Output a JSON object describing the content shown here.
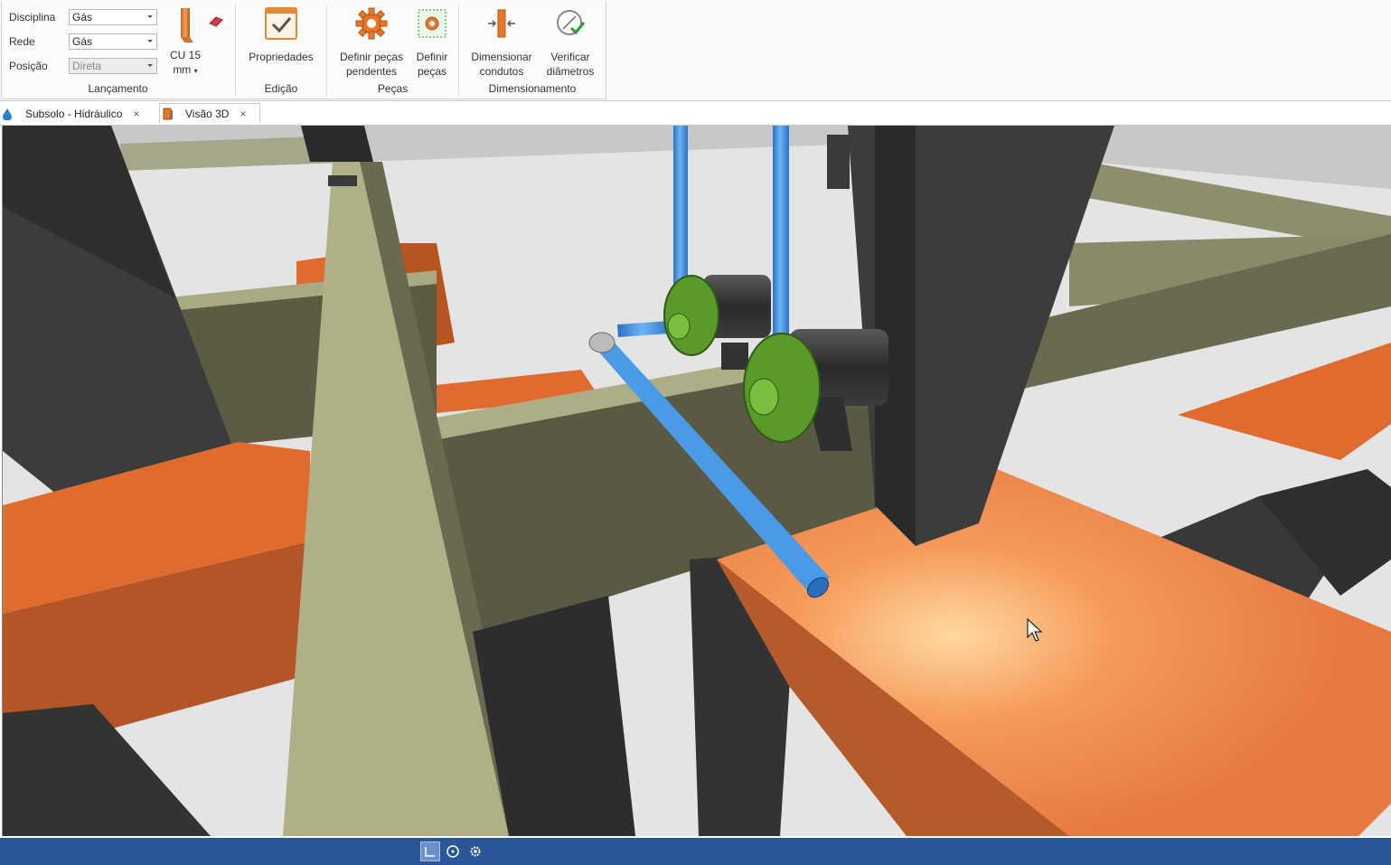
{
  "ribbon": {
    "lancamento": {
      "label": "Lançamento",
      "disciplina": {
        "label": "Disciplina",
        "value": "Gás"
      },
      "rede": {
        "label": "Rede",
        "value": "Gás"
      },
      "posicao": {
        "label": "Posição",
        "value": "Direta"
      },
      "material": {
        "line1": "CU 15",
        "line2": "mm"
      }
    },
    "edicao": {
      "label": "Edição",
      "propriedades": "Propriedades"
    },
    "pecas": {
      "label": "Peças",
      "definir_pendentes_line1": "Definir peças",
      "definir_pendentes_line2": "pendentes",
      "definir_line1": "Definir",
      "definir_line2": "peças"
    },
    "dimensionamento": {
      "label": "Dimensionamento",
      "dimensionar_line1": "Dimensionar",
      "dimensionar_line2": "condutos",
      "verificar_line1": "Verificar",
      "verificar_line2": "diâmetros"
    }
  },
  "tabs": [
    {
      "label": "Subsolo - Hidráulico",
      "close": "×"
    },
    {
      "label": "Visão 3D",
      "close": "×"
    }
  ],
  "colors": {
    "beam_orange": "#e06b2e",
    "beam_olive": "#8c8c6a",
    "column_dark": "#3c3c3c",
    "pipe_blue": "#3b8fe0",
    "pump_green": "#5a9a2a",
    "status_bar": "#2b579a"
  },
  "statusbar": {
    "icons": [
      "ortho-icon",
      "snap-icon",
      "settings-icon"
    ]
  }
}
